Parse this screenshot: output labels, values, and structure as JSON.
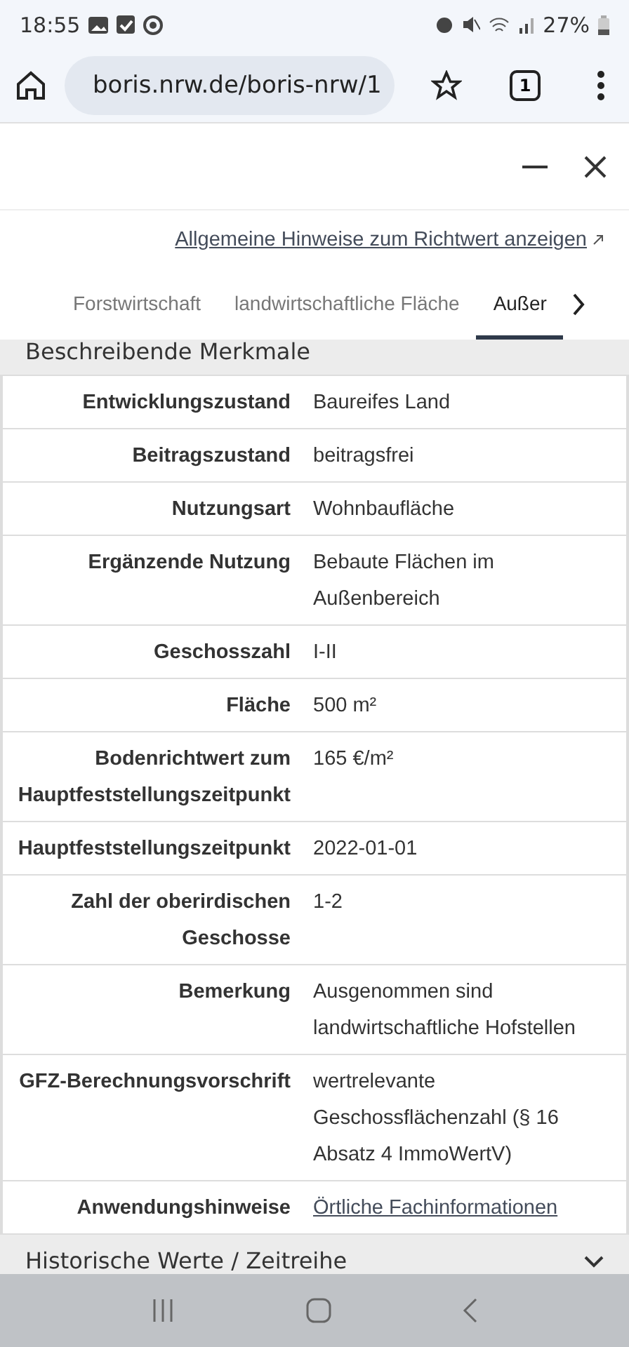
{
  "status_bar": {
    "time": "18:55",
    "battery": "27%"
  },
  "browser": {
    "url": "boris.nrw.de/boris-nrw/1",
    "tab_count": "1"
  },
  "link": "Allgemeine Hinweise zum Richtwert anzeigen",
  "tabs": [
    {
      "label": "Forstwirtschaft",
      "selected": false
    },
    {
      "label": "landwirtschaftliche Fläche",
      "selected": false
    },
    {
      "label": "Außer",
      "selected": true
    }
  ],
  "section": {
    "title": "Beschreibende Merkmale"
  },
  "rows": [
    {
      "label": "Entwicklungszustand",
      "value": "Baureifes Land",
      "kind": "text"
    },
    {
      "label": "Beitragszustand",
      "value": "beitragsfrei",
      "kind": "text"
    },
    {
      "label": "Nutzungsart",
      "value": "Wohnbaufläche",
      "kind": "text"
    },
    {
      "label": "Ergänzende Nutzung",
      "value": "Bebaute Flächen im Außenbereich",
      "kind": "text"
    },
    {
      "label": "Geschosszahl",
      "value": "I-II",
      "kind": "text"
    },
    {
      "label": "Fläche",
      "value": "500 m²",
      "kind": "text"
    },
    {
      "label": "Bodenrichtwert zum Hauptfeststellungszeitpunkt",
      "value": "165 €/m²",
      "kind": "text"
    },
    {
      "label": "Hauptfeststellungszeitpunkt",
      "value": "2022-01-01",
      "kind": "text"
    },
    {
      "label": "Zahl der oberirdischen Geschosse",
      "value": "1-2",
      "kind": "text"
    },
    {
      "label": "Bemerkung",
      "value": "Ausgenommen sind landwirtschaftliche Hofstellen",
      "kind": "text"
    },
    {
      "label": "GFZ-Berechnungsvorschrift",
      "value": "wertrelevante Geschossflächenzahl (§ 16 Absatz 4 ImmoWertV)",
      "kind": "text"
    },
    {
      "label": "Anwendungshinweise",
      "value": "Örtliche Fachinformationen",
      "kind": "link"
    }
  ],
  "next_section": {
    "title": "Historische Werte / Zeitreihe",
    "expanded": false
  }
}
